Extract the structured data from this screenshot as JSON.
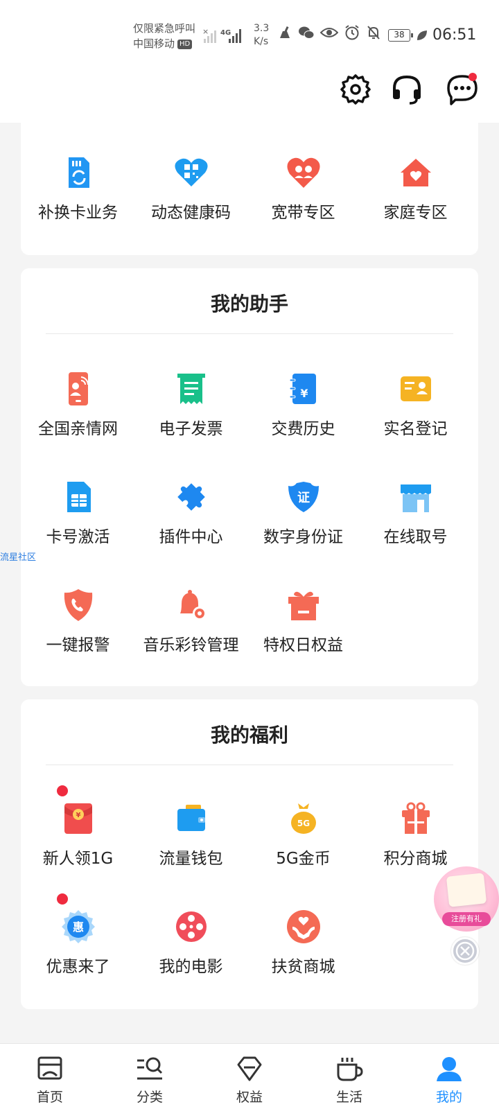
{
  "status_bar": {
    "emergency_text": "仅限紧急呼叫",
    "carrier": "中国移动",
    "hd_badge": "HD",
    "speed_value": "3.3",
    "speed_unit": "K/s",
    "battery": "38",
    "time": "06:51"
  },
  "header": {
    "icons": [
      "gear-icon",
      "headset-icon",
      "chat-bubble-icon"
    ]
  },
  "services_top": {
    "items": [
      {
        "label": "补换卡业务",
        "icon": "sim-swap-icon"
      },
      {
        "label": "动态健康码",
        "icon": "health-code-heart-icon"
      },
      {
        "label": "宽带专区",
        "icon": "broadband-heart-icon"
      },
      {
        "label": "家庭专区",
        "icon": "home-icon"
      }
    ]
  },
  "assistant": {
    "title": "我的助手",
    "items": [
      {
        "label": "全国亲情网",
        "icon": "family-phone-icon"
      },
      {
        "label": "电子发票",
        "icon": "invoice-icon"
      },
      {
        "label": "交费历史",
        "icon": "payment-history-icon"
      },
      {
        "label": "实名登记",
        "icon": "id-card-icon"
      },
      {
        "label": "卡号激活",
        "icon": "sim-card-icon"
      },
      {
        "label": "插件中心",
        "icon": "puzzle-icon"
      },
      {
        "label": "数字身份证",
        "icon": "digital-id-shield-icon"
      },
      {
        "label": "在线取号",
        "icon": "store-icon"
      },
      {
        "label": "一键报警",
        "icon": "alarm-shield-icon"
      },
      {
        "label": "音乐彩铃管理",
        "icon": "ringtone-bell-icon"
      },
      {
        "label": "特权日权益",
        "icon": "gift-box-icon"
      }
    ]
  },
  "welfare": {
    "title": "我的福利",
    "items": [
      {
        "label": "新人领1G",
        "icon": "red-envelope-icon",
        "badge": true
      },
      {
        "label": "流量钱包",
        "icon": "wallet-icon",
        "badge": false
      },
      {
        "label": "5G金币",
        "icon": "coin-bag-icon",
        "badge": false
      },
      {
        "label": "积分商城",
        "icon": "points-gift-icon",
        "badge": false
      },
      {
        "label": "优惠来了",
        "icon": "discount-badge-icon",
        "badge": true
      },
      {
        "label": "我的电影",
        "icon": "film-reel-icon",
        "badge": false
      },
      {
        "label": "扶贫商城",
        "icon": "charity-hands-icon",
        "badge": false
      }
    ]
  },
  "side_link": "流星社区",
  "float_promo": {
    "tag": "注册有礼"
  },
  "tabbar": {
    "tabs": [
      {
        "label": "首页",
        "icon": "home-tab-icon",
        "active": false
      },
      {
        "label": "分类",
        "icon": "category-search-icon",
        "active": false
      },
      {
        "label": "权益",
        "icon": "diamond-icon",
        "active": false
      },
      {
        "label": "生活",
        "icon": "coffee-cup-icon",
        "active": false
      },
      {
        "label": "我的",
        "icon": "user-icon",
        "active": true
      }
    ]
  },
  "colors": {
    "accent": "#1e90ff",
    "badge_red": "#ef2b3f"
  }
}
